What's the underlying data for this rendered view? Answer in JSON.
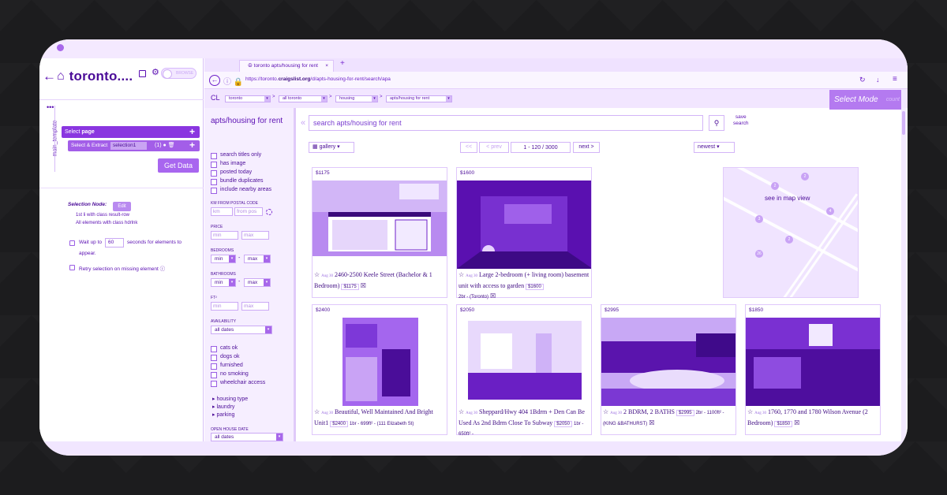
{
  "scraper": {
    "title": "toronto....",
    "toggle_label": "BROWSE",
    "tab_label": "main_template",
    "select_row": {
      "prefix": "Select ",
      "value": "page"
    },
    "extract_row": {
      "prefix": "Select & Extract ",
      "value": "selection1",
      "count": "(1)"
    },
    "get_data": "Get Data",
    "selection_node_label": "Selection Node:",
    "edit_label": "Edit",
    "node_line1": "1st li with class result-row",
    "node_line2": "All elements with class hdrlnk",
    "wait_prefix": "Wait up to",
    "wait_value": "60",
    "wait_suffix": "seconds for elements to",
    "wait_suffix2": "appear.",
    "retry_text": "Retry selection on missing element"
  },
  "browser": {
    "tab_title": "toronto apts/housing for rent",
    "url_prefix": "https://toronto.",
    "url_domain": "craigslist.org",
    "url_suffix": "/d/apts-housing-for-rent/search/apa"
  },
  "cl_bar": {
    "logo": "CL",
    "crumbs": [
      "toronto",
      "all toronto",
      "housing",
      "apts/housing for rent"
    ],
    "select_mode": "Select Mode",
    "select_mode_ghost": "count"
  },
  "filters": {
    "title": "apts/housing for rent",
    "checks1": [
      "search titles only",
      "has image",
      "posted today",
      "bundle duplicates",
      "include nearby areas"
    ],
    "postal_label": "KM FROM POSTAL CODE",
    "km_placeholder": "km",
    "from_placeholder": "from pos",
    "price_label": "PRICE",
    "min_placeholder": "min",
    "max_placeholder": "max",
    "bedrooms_label": "BEDROOMS",
    "bathrooms_label": "BATHROOMS",
    "ft_label": "FT²",
    "min_sel": "min",
    "max_sel": "max",
    "dash": "-",
    "availability_label": "AVAILABILITY",
    "all_dates": "all dates",
    "checks2": [
      "cats ok",
      "dogs ok",
      "furnished",
      "no smoking",
      "wheelchair access"
    ],
    "links": [
      "housing type",
      "laundry",
      "parking"
    ],
    "open_house_label": "OPEN HOUSE DATE"
  },
  "results": {
    "search_placeholder": "search apts/housing for rent",
    "save_search": [
      "save",
      "search"
    ],
    "view": "gallery",
    "pager_first": "<<",
    "pager_prev": "< prev",
    "pager_count": "1 - 120 / 3000",
    "pager_next": "next >",
    "sort": "newest",
    "map_label": "see in map view",
    "listings": [
      {
        "price": "$1175",
        "date": "Aug 30",
        "title": "2460-2500 Keele Street (Bachelor & 1 Bedroom)",
        "chip": "$1175",
        "meta": ""
      },
      {
        "price": "$1600",
        "date": "Aug 30",
        "title": "Large 2-bedroom (+ living room) basement unit with access to garden",
        "chip": "$1600",
        "meta": "2br - (Toronto)"
      },
      {
        "price": "$2400",
        "date": "Aug 30",
        "title": "Beautiful, Well Maintained And Bright Unit1",
        "chip": "$2400",
        "meta": "1br - 699ft² - (111 Elizabeth St)"
      },
      {
        "price": "$2050",
        "date": "Aug 30",
        "title": "Sheppard/Hwy 404 1Bdrm + Den Can Be Used As 2nd Bdrm Close To Subway",
        "chip": "$2050",
        "meta": "1br - 650ft² -"
      },
      {
        "price": "$2995",
        "date": "Aug 30",
        "title": "2 BDRM, 2 BATHS",
        "chip": "$2995",
        "meta": "2br - 1100ft² - (KING &BATHURST)"
      },
      {
        "price": "$1850",
        "date": "Aug 30",
        "title": "1760, 1770 and 1780 Wilson Avenue (2 Bedroom)",
        "chip": "$1850",
        "meta": ""
      }
    ]
  },
  "colors": {
    "accent": "#8a36e0",
    "tint": "#f4e9ff",
    "frame": "#1c1c1e"
  }
}
